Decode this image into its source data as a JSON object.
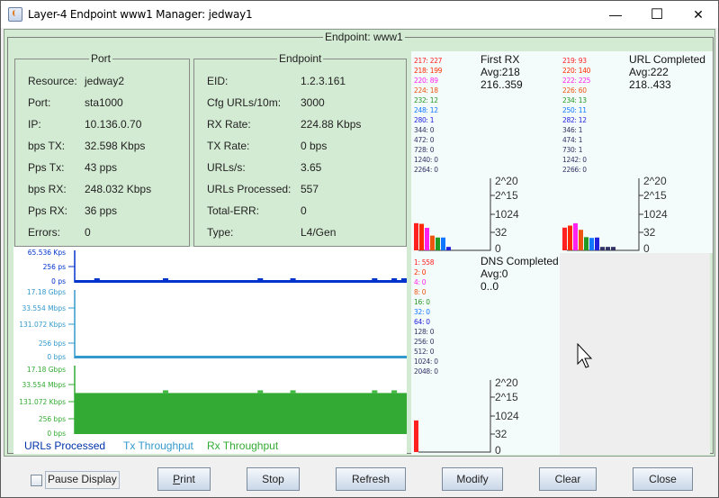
{
  "window": {
    "title": "Layer-4 Endpoint www1  Manager: jedway1",
    "minimize_glyph": "—",
    "maximize_glyph": "☐",
    "close_glyph": "✕"
  },
  "outer_group_title": "Endpoint: www1",
  "port": {
    "title": "Port",
    "rows": [
      {
        "label": "Resource:",
        "value": "jedway2"
      },
      {
        "label": "Port:",
        "value": "sta1000"
      },
      {
        "label": "IP:",
        "value": "10.136.0.70"
      },
      {
        "label": "bps TX:",
        "value": "32.598 Kbps"
      },
      {
        "label": "Pps Tx:",
        "value": "43 pps"
      },
      {
        "label": "bps RX:",
        "value": "248.032 Kbps"
      },
      {
        "label": "Pps RX:",
        "value": "36 pps"
      },
      {
        "label": "Errors:",
        "value": "0"
      }
    ]
  },
  "endpoint": {
    "title": "Endpoint",
    "rows": [
      {
        "label": "EID:",
        "value": "1.2.3.161"
      },
      {
        "label": "Cfg URLs/10m:",
        "value": "3000"
      },
      {
        "label": "RX Rate:",
        "value": "224.88 Kbps"
      },
      {
        "label": "TX Rate:",
        "value": "0 bps"
      },
      {
        "label": "URLs/s:",
        "value": "3.65"
      },
      {
        "label": "URLs Processed:",
        "value": "557"
      },
      {
        "label": "Total-ERR:",
        "value": "0"
      },
      {
        "label": "Type:",
        "value": "L4/Gen"
      }
    ]
  },
  "strip_charts": {
    "urls": {
      "ticks": [
        "65.536 Kps",
        "256 ps",
        "0 ps"
      ],
      "color": "#0033cc",
      "level_fraction": 0.02,
      "bumps": [
        0.06,
        0.27,
        0.56,
        0.66,
        0.91,
        0.97,
        1.0
      ]
    },
    "tx": {
      "ticks": [
        "17.18 Gbps",
        "33.554 Mbps",
        "131.072 Kbps",
        "256 bps",
        "0 bps"
      ],
      "color": "#3399cc",
      "level_fraction": 0.0
    },
    "rx": {
      "ticks": [
        "17.18 Gbps",
        "33.554 Mbps",
        "131.072 Kbps",
        "256 bps",
        "0 bps"
      ],
      "color": "#33aa33",
      "level_fraction": 0.6,
      "bumps": [
        0.27,
        0.56,
        0.66,
        0.91,
        0.97
      ]
    },
    "legend": [
      {
        "label": "URLs Processed",
        "color": "#0033aa"
      },
      {
        "label": "Tx Throughput",
        "color": "#3399cc"
      },
      {
        "label": "Rx Throughput",
        "color": "#33aa33"
      }
    ]
  },
  "histograms": [
    {
      "title": "First RX",
      "avg": "Avg:218",
      "range": "216..359",
      "buckets": [
        {
          "label": "217: 227",
          "count": 227,
          "color": "#ff2020"
        },
        {
          "label": "218: 199",
          "count": 199,
          "color": "#ff2a00"
        },
        {
          "label": "220: 89",
          "count": 89,
          "color": "#ff22ee"
        },
        {
          "label": "224: 18",
          "count": 18,
          "color": "#ee5511"
        },
        {
          "label": "232: 12",
          "count": 12,
          "color": "#229922"
        },
        {
          "label": "248: 12",
          "count": 12,
          "color": "#1177ff"
        },
        {
          "label": "280: 1",
          "count": 1,
          "color": "#2222dd"
        },
        {
          "label": "344: 0",
          "count": 0,
          "color": "#333366"
        },
        {
          "label": "472: 0",
          "count": 0,
          "color": "#333366"
        },
        {
          "label": "728: 0",
          "count": 0,
          "color": "#333366"
        },
        {
          "label": "1240: 0",
          "count": 0,
          "color": "#333366"
        },
        {
          "label": "2264: 0",
          "count": 0,
          "color": "#333366"
        }
      ],
      "axis_ticks": [
        "2^20",
        "2^15",
        "1024",
        "32",
        "0"
      ]
    },
    {
      "title": "URL Completed",
      "avg": "Avg:222",
      "range": "218..433",
      "buckets": [
        {
          "label": "219: 93",
          "count": 93,
          "color": "#ff2020"
        },
        {
          "label": "220: 140",
          "count": 140,
          "color": "#ff2a00"
        },
        {
          "label": "222: 225",
          "count": 225,
          "color": "#ff22ee"
        },
        {
          "label": "226: 60",
          "count": 60,
          "color": "#ee5511"
        },
        {
          "label": "234: 13",
          "count": 13,
          "color": "#229922"
        },
        {
          "label": "250: 11",
          "count": 11,
          "color": "#1177ff"
        },
        {
          "label": "282: 12",
          "count": 12,
          "color": "#2222dd"
        },
        {
          "label": "346: 1",
          "count": 1,
          "color": "#333366"
        },
        {
          "label": "474: 1",
          "count": 1,
          "color": "#333366"
        },
        {
          "label": "730: 1",
          "count": 1,
          "color": "#333366"
        },
        {
          "label": "1242: 0",
          "count": 0,
          "color": "#333366"
        },
        {
          "label": "2266: 0",
          "count": 0,
          "color": "#333366"
        }
      ],
      "axis_ticks": [
        "2^20",
        "2^15",
        "1024",
        "32",
        "0"
      ]
    },
    {
      "title": "DNS Completed",
      "avg": "Avg:0",
      "range": "0..0",
      "buckets": [
        {
          "label": "1: 558",
          "count": 558,
          "color": "#ff2020"
        },
        {
          "label": "2: 0",
          "count": 0,
          "color": "#ff2a00"
        },
        {
          "label": "4: 0",
          "count": 0,
          "color": "#ff22ee"
        },
        {
          "label": "8: 0",
          "count": 0,
          "color": "#ee5511"
        },
        {
          "label": "16: 0",
          "count": 0,
          "color": "#229922"
        },
        {
          "label": "32: 0",
          "count": 0,
          "color": "#1177ff"
        },
        {
          "label": "64: 0",
          "count": 0,
          "color": "#2222dd"
        },
        {
          "label": "128: 0",
          "count": 0,
          "color": "#333366"
        },
        {
          "label": "256: 0",
          "count": 0,
          "color": "#333366"
        },
        {
          "label": "512: 0",
          "count": 0,
          "color": "#333366"
        },
        {
          "label": "1024: 0",
          "count": 0,
          "color": "#333366"
        },
        {
          "label": "2048: 0",
          "count": 0,
          "color": "#333366"
        }
      ],
      "axis_ticks": [
        "2^20",
        "2^15",
        "1024",
        "32",
        "0"
      ]
    }
  ],
  "footer": {
    "pause_label": "Pause Display",
    "pause_checked": false,
    "buttons": [
      "Print",
      "Stop",
      "Refresh",
      "Modify",
      "Clear",
      "Close"
    ]
  }
}
